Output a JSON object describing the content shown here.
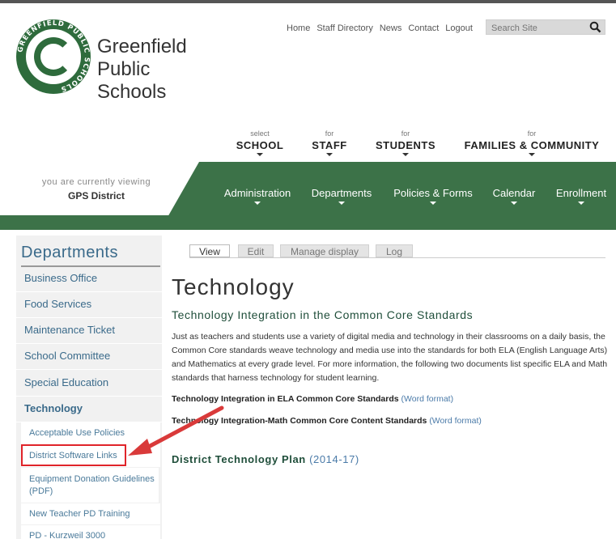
{
  "brand": {
    "line1": "Greenfield",
    "line2": "Public",
    "line3": "Schools",
    "seal_text": "GREENFIELD PUBLIC SCHOOLS"
  },
  "topnav": [
    "Home",
    "Staff Directory",
    "News",
    "Contact",
    "Logout"
  ],
  "search": {
    "placeholder": "Search Site",
    "icon": "search-icon"
  },
  "audience_nav": [
    {
      "pre": "select",
      "label": "SCHOOL"
    },
    {
      "pre": "for",
      "label": "STAFF"
    },
    {
      "pre": "for",
      "label": "STUDENTS"
    },
    {
      "pre": "for",
      "label": "FAMILIES & COMMUNITY"
    }
  ],
  "viewing": {
    "label": "you are currently viewing",
    "value": "GPS District"
  },
  "main_nav": [
    "Administration",
    "Departments",
    "Policies & Forms",
    "Calendar",
    "Enrollment"
  ],
  "sidebar": {
    "title": "Departments",
    "items": [
      "Business Office",
      "Food Services",
      "Maintenance Ticket",
      "School Committee",
      "Special Education",
      "Technology"
    ],
    "active": "Technology",
    "subitems": [
      "Acceptable Use Policies",
      "District Software Links",
      "Equipment Donation Guidelines (PDF)",
      "New Teacher PD Training",
      "PD - Kurzweil 3000"
    ]
  },
  "tabs": [
    "View",
    "Edit",
    "Manage display",
    "Log"
  ],
  "content": {
    "title": "Technology",
    "subhead": "Technology Integration in the Common Core Standards",
    "paragraph": "Just as teachers and students use a variety of digital media and technology in their classrooms on a daily basis, the Common Core standards weave technology and media use into the standards for both ELA (English Language Arts) and Mathematics at every grade level. For more information, the following two documents list specific ELA and Math standards that harness technology for student learning.",
    "doc1_title": "Technology Integration in ELA Common Core Standards",
    "doc1_link": "(Word format)",
    "doc2_title": "Technology Integration-Math Common Core Content Standards",
    "doc2_link": "(Word format)",
    "plan_title": "District Technology Plan",
    "plan_link": "(2014-17)"
  },
  "colors": {
    "green": "#3c7248",
    "link": "#4a7aa8",
    "highlight": "#e0242a"
  }
}
